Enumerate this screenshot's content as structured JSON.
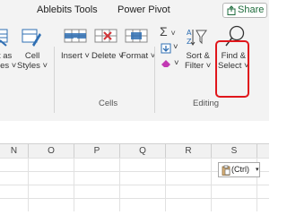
{
  "tabs": [
    {
      "label": "Ablebits Tools"
    },
    {
      "label": "Power Pivot"
    }
  ],
  "share": {
    "label": "Share",
    "icon": "share-icon"
  },
  "ribbon": {
    "partial_styles": {
      "line1": "t as",
      "line2": "les ˅"
    },
    "cell_styles": {
      "line1": "Cell",
      "line2": "Styles ˅"
    },
    "insert": {
      "label": "Insert ˅"
    },
    "delete": {
      "label": "Delete ˅"
    },
    "format": {
      "label": "Format ˅"
    },
    "cells_group": "Cells",
    "editing_group": "Editing",
    "autosum_caret": "˅",
    "fill_caret": "˅",
    "clear_caret": "˅",
    "sort_filter": {
      "line1": "Sort &",
      "line2": "Filter ˅"
    },
    "find_select": {
      "line1": "Find &",
      "line2": "Select ˅"
    },
    "highlight_color": "#e0161b"
  },
  "grid": {
    "columns": [
      "N",
      "O",
      "P",
      "Q",
      "R",
      "S"
    ]
  },
  "paste_options": {
    "label": "(Ctrl)",
    "caret": "▾"
  },
  "colors": {
    "accent_green": "#1e6b3c",
    "ribbon_bg": "#f3f3f3",
    "highlight": "#e0161b"
  }
}
